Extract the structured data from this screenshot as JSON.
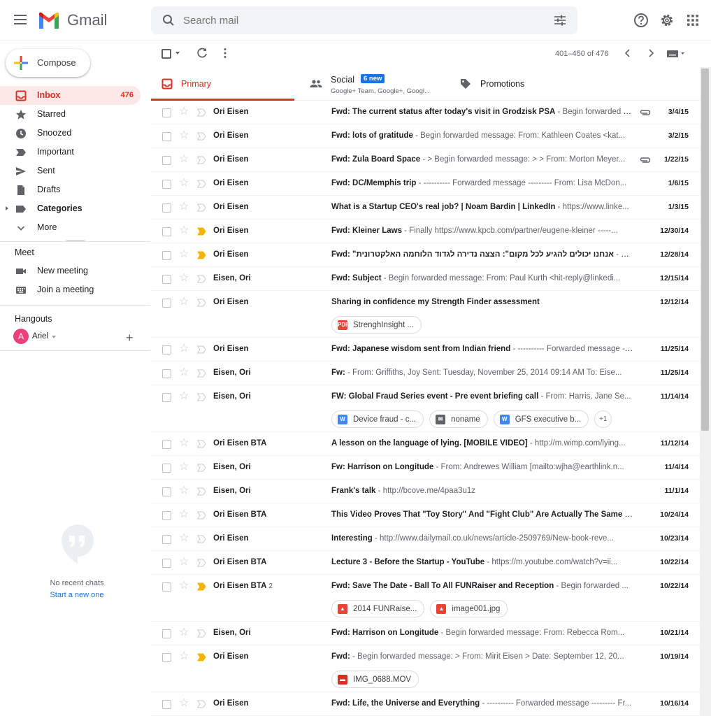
{
  "app": {
    "name": "Gmail"
  },
  "search": {
    "placeholder": "Search mail"
  },
  "compose": {
    "label": "Compose"
  },
  "sidebar": {
    "items": [
      {
        "label": "Inbox",
        "count": "476",
        "icon": "inbox-icon"
      },
      {
        "label": "Starred",
        "icon": "star-icon"
      },
      {
        "label": "Snoozed",
        "icon": "clock-icon"
      },
      {
        "label": "Important",
        "icon": "important-icon"
      },
      {
        "label": "Sent",
        "icon": "send-icon"
      },
      {
        "label": "Drafts",
        "icon": "draft-icon"
      },
      {
        "label": "Categories",
        "icon": "label-icon"
      },
      {
        "label": "More",
        "icon": "chevron-down-icon"
      }
    ],
    "meet": {
      "title": "Meet",
      "items": [
        {
          "label": "New meeting",
          "icon": "video-icon"
        },
        {
          "label": "Join a meeting",
          "icon": "keyboard-icon"
        }
      ]
    },
    "hangouts": {
      "title": "Hangouts",
      "user_initial": "A",
      "user_name": "Ariel",
      "no_chats": "No recent chats",
      "start_new": "Start a new one"
    }
  },
  "toolbar": {
    "pager": "401–450 of 476"
  },
  "tabs": {
    "primary": "Primary",
    "social": "Social",
    "social_badge": "6 new",
    "social_sub": "Google+ Team, Google+, Googl...",
    "promotions": "Promotions"
  },
  "emails": [
    {
      "sender": "Ori Eisen",
      "subject": "Fwd: The current status after today's visit in Grodzisk PSA",
      "snippet": " - Begin forwarded message: From: ...",
      "date": "3/4/15",
      "important": false,
      "clip": true
    },
    {
      "sender": "Ori Eisen",
      "subject": "Fwd: lots of gratitude",
      "snippet": " - Begin forwarded message: From: Kathleen Coates <kat...",
      "date": "3/2/15",
      "important": false,
      "clip": false
    },
    {
      "sender": "Ori Eisen",
      "subject": "Fwd: Zula Board Space",
      "snippet": " - > Begin forwarded message: > > From: Morton Meyer...",
      "date": "1/22/15",
      "important": false,
      "clip": true
    },
    {
      "sender": "Ori Eisen",
      "subject": "Fwd: DC/Memphis trip",
      "snippet": " - ---------- Forwarded message --------- From: Lisa McDon...",
      "date": "1/6/15",
      "important": false,
      "clip": false
    },
    {
      "sender": "Ori Eisen",
      "subject": "What is a Startup CEO's real job? | Noam Bardin | LinkedIn",
      "snippet": " - https://www.linke...",
      "date": "1/3/15",
      "important": false,
      "clip": false
    },
    {
      "sender": "Ori Eisen",
      "subject": "Fwd: Kleiner Laws",
      "snippet": " - Finally https://www.kpcb.com/partner/eugene-kleiner -----...",
      "date": "12/30/14",
      "important": true,
      "clip": false
    },
    {
      "sender": "Ori Eisen",
      "subject": "Fwd: \"אנחנו יכולים להגיע לכל מקום\": הצצה נדירה לגדוד הלוחמה האלקטרונית",
      "snippet": " - Begin...",
      "date": "12/28/14",
      "important": true,
      "clip": false
    },
    {
      "sender": "Eisen, Ori",
      "subject": "Fwd: Subject",
      "snippet": " - Begin forwarded message: From: Paul Kurth <hit-reply@linkedi...",
      "date": "12/15/14",
      "important": false,
      "clip": false
    },
    {
      "sender": "Ori Eisen",
      "subject": "Sharing in confidence my Strength Finder assessment",
      "snippet": "",
      "date": "12/12/14",
      "important": false,
      "clip": false,
      "attachments": [
        {
          "name": "StrenghInsight ...",
          "type": "pdf"
        }
      ]
    },
    {
      "sender": "Ori Eisen",
      "subject": "Fwd: Japanese wisdom sent from Indian friend",
      "snippet": " - ---------- Forwarded message ---...",
      "date": "11/25/14",
      "important": false,
      "clip": false
    },
    {
      "sender": "Eisen, Ori",
      "subject": "Fw:",
      "snippet": " - From: Griffiths, Joy Sent: Tuesday, November 25, 2014 09:14 AM To: Eise...",
      "date": "11/25/14",
      "important": false,
      "clip": false
    },
    {
      "sender": "Eisen, Ori",
      "subject": "FW: Global Fraud Series event - Pre event briefing call",
      "snippet": " - From: Harris, Jane Se...",
      "date": "11/14/14",
      "important": false,
      "clip": false,
      "attachments": [
        {
          "name": "Device fraud - c...",
          "type": "word"
        },
        {
          "name": "noname",
          "type": "mail"
        },
        {
          "name": "GFS executive b...",
          "type": "word"
        }
      ],
      "more": "+1"
    },
    {
      "sender": "Ori Eisen BTA",
      "subject": "A lesson on the language of lying. [MOBILE VIDEO]",
      "snippet": " - http://m.wimp.com/lying...",
      "date": "11/12/14",
      "important": false,
      "clip": false
    },
    {
      "sender": "Eisen, Ori",
      "subject": "Fw: Harrison on Longitude",
      "snippet": " - From: Andrewes William [mailto:wjha@earthlink.n...",
      "date": "11/4/14",
      "important": false,
      "clip": false
    },
    {
      "sender": "Eisen, Ori",
      "subject": "Frank's talk",
      "snippet": " - http://bcove.me/4paa3u1z",
      "date": "11/1/14",
      "important": false,
      "clip": false
    },
    {
      "sender": "Ori Eisen BTA",
      "subject": "This Video Proves That \"Toy Story\" And \"Fight Club\" Are Actually The Same M...",
      "snippet": "",
      "date": "10/24/14",
      "important": false,
      "clip": false
    },
    {
      "sender": "Ori Eisen",
      "subject": "Interesting",
      "snippet": " - http://www.dailymail.co.uk/news/article-2509769/New-book-reve...",
      "date": "10/23/14",
      "important": false,
      "clip": false
    },
    {
      "sender": "Ori Eisen BTA",
      "subject": "Lecture 3 - Before the Startup - YouTube",
      "snippet": " - https://m.youtube.com/watch?v=ii...",
      "date": "10/22/14",
      "important": false,
      "clip": false
    },
    {
      "sender": "Ori Eisen BTA",
      "count": "2",
      "subject": "Fwd: Save The Date - Ball To All FUNRaiser and Reception",
      "snippet": " - Begin forwarded ...",
      "date": "10/22/14",
      "important": true,
      "clip": false,
      "attachments": [
        {
          "name": "2014 FUNRaise...",
          "type": "image"
        },
        {
          "name": "image001.jpg",
          "type": "image"
        }
      ]
    },
    {
      "sender": "Eisen, Ori",
      "subject": "Fwd: Harrison on Longitude",
      "snippet": " - Begin forwarded message: From: Rebecca Rom...",
      "date": "10/21/14",
      "important": false,
      "clip": false
    },
    {
      "sender": "Ori Eisen",
      "subject": "Fwd:",
      "snippet": " - Begin forwarded message: > From: Mirit Eisen > Date: September 12, 20...",
      "date": "10/19/14",
      "important": true,
      "clip": false,
      "attachments": [
        {
          "name": "IMG_0688.MOV",
          "type": "video"
        }
      ]
    },
    {
      "sender": "Ori Eisen",
      "subject": "Fwd: Life, the Universe and Everything",
      "snippet": " - ---------- Forwarded message --------- Fr...",
      "date": "10/16/14",
      "important": false,
      "clip": false
    }
  ],
  "colors": {
    "accent": "#d93025",
    "active_bg": "#fce8e6",
    "important": "#f4b400",
    "link": "#1a73e8"
  }
}
